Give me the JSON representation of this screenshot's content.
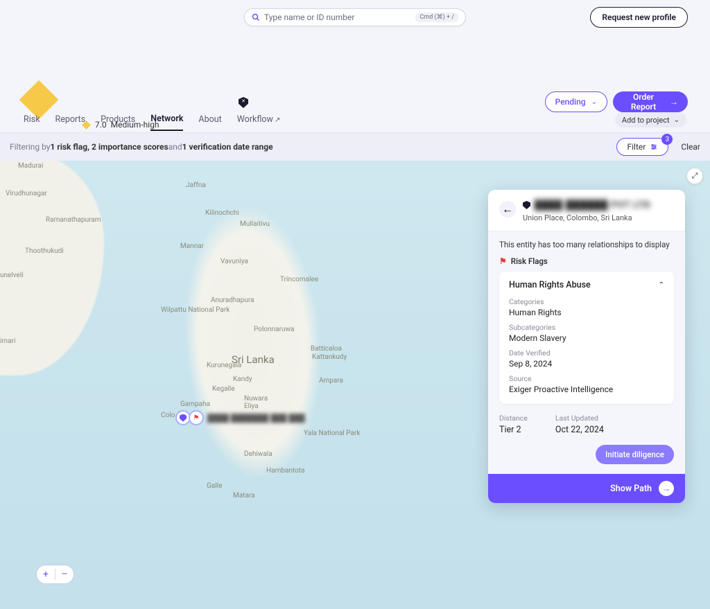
{
  "search": {
    "placeholder": "Type name or ID number",
    "shortcut": "Cmd (⌘) + /"
  },
  "header": {
    "request_new_profile": "Request new profile",
    "score_value": "7.0",
    "score_label": "Medium-high",
    "pending_label": "Pending",
    "order_report_label": "Order Report"
  },
  "tabs": {
    "items": [
      "Risk",
      "Reports",
      "Products",
      "Network",
      "About",
      "Workflow"
    ],
    "active": "Network",
    "add_to_project": "Add to project"
  },
  "filter": {
    "prefix": "Filtering by ",
    "part1": "1 risk flag, 2 importance scores",
    "conj": " and ",
    "part2": "1 verification date range",
    "filter_label": "Filter",
    "filter_count": "3",
    "clear_label": "Clear"
  },
  "map": {
    "country": "Sri Lanka",
    "pin_label": "████ ███████ ███ ███",
    "labels": {
      "jaffna": "Jaffna",
      "kilinochchi": "Kilinochchi",
      "mullaitivu": "Mullaitivu",
      "mannar": "Mannar",
      "vavuniya": "Vavuniya",
      "trincomalee": "Trincomalee",
      "anuradhapura": "Anuradhapura",
      "polonnaruwa": "Polonnaruwa",
      "batticaloa": "Batticaloa",
      "kattankudy": "Kattankudy",
      "ampara": "Ampara",
      "kurunegala": "Kurunegala",
      "kandy": "Kandy",
      "kegalle": "Kegalle",
      "nuwara": "Nuwara\nEliya",
      "gampaha": "Gampaha",
      "colombo": "Colo",
      "dehiwala": "Dehiwala",
      "galle": "Galle",
      "matara": "Matara",
      "hambantota": "Hambantota",
      "yala": "Yala National Park",
      "wilpattu": "Wilpattu National Park",
      "madurai": "Madurai",
      "virudhunagar": "Virudhunagar",
      "ramanatha": "Ramanathapuram",
      "thoothukudi": "Thoothukudi",
      "tirunelveli": "unelveli",
      "imari": "imari"
    },
    "zoom_in": "+",
    "zoom_out": "–"
  },
  "panel": {
    "entity_name_blurred": "████ ██████ PVT LTD",
    "entity_address": "Union Place, Colombo, Sri Lanka",
    "relationship_msg": "This entity has too many relationships to display",
    "risk_section": "Risk Flags",
    "risk_title": "Human Rights Abuse",
    "categories_k": "Categories",
    "categories_v": "Human Rights",
    "subcat_k": "Subcategories",
    "subcat_v": "Modern Slavery",
    "date_verified_k": "Date Verified",
    "date_verified_v": "Sep 8, 2024",
    "source_k": "Source",
    "source_v": "Exiger Proactive Intelligence",
    "distance_k": "Distance",
    "distance_v": "Tier 2",
    "last_updated_k": "Last Updated",
    "last_updated_v": "Oct 22, 2024",
    "diligence_btn": "Initiate diligence",
    "show_path": "Show Path"
  }
}
